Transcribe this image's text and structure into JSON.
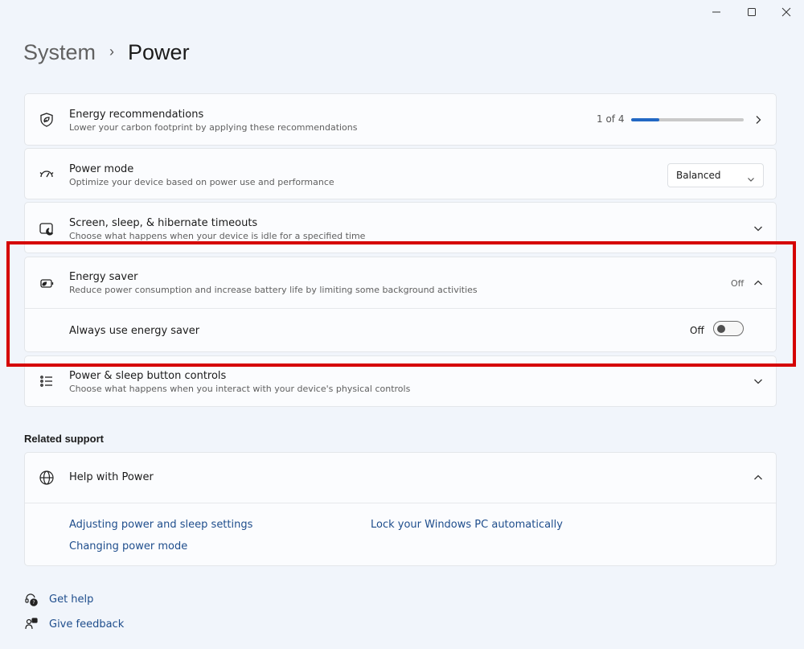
{
  "window": {
    "minimize_icon": "minimize-icon",
    "maximize_icon": "maximize-icon",
    "close_icon": "close-icon"
  },
  "breadcrumb": {
    "parent": "System",
    "separator": "›",
    "current": "Power"
  },
  "settings": {
    "energy_recommendations": {
      "title": "Energy recommendations",
      "description": "Lower your carbon footprint by applying these recommendations",
      "progress_text": "1 of 4",
      "progress_fraction": 0.25,
      "icon": "leaf-shield-icon"
    },
    "power_mode": {
      "title": "Power mode",
      "description": "Optimize your device based on power use and performance",
      "selected": "Balanced",
      "icon": "gauge-icon"
    },
    "screen_sleep": {
      "title": "Screen, sleep, & hibernate timeouts",
      "description": "Choose what happens when your device is idle for a specified time",
      "icon": "screen-moon-icon"
    },
    "energy_saver": {
      "title": "Energy saver",
      "description": "Reduce power consumption and increase battery life by limiting some background activities",
      "state": "Off",
      "icon": "battery-leaf-icon",
      "always_label": "Always use energy saver",
      "toggle_state": "Off"
    },
    "power_buttons": {
      "title": "Power & sleep button controls",
      "description": "Choose what happens when you interact with your device's physical controls",
      "icon": "list-icon"
    }
  },
  "related_support": {
    "heading": "Related support",
    "help_title": "Help with Power",
    "links": [
      "Adjusting power and sleep settings",
      "Lock your Windows PC automatically",
      "Changing power mode"
    ]
  },
  "footer": {
    "get_help": "Get help",
    "give_feedback": "Give feedback"
  },
  "colors": {
    "accent": "#2268c4",
    "highlight": "#d50000",
    "link": "#1e4d8c",
    "background": "#f1f5fb"
  }
}
